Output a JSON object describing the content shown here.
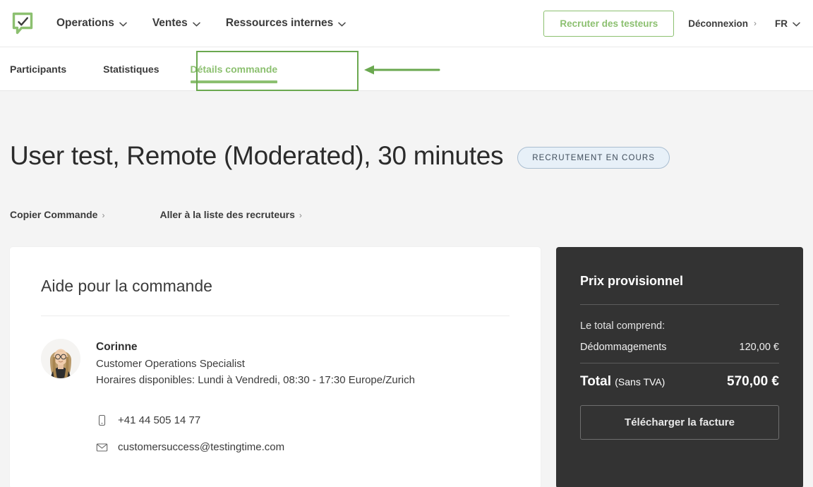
{
  "header": {
    "logo_icon": "speech-bubble-check-logo",
    "nav": [
      {
        "label": "Operations",
        "icon": "chevron-down-icon"
      },
      {
        "label": "Ventes",
        "icon": "chevron-down-icon"
      },
      {
        "label": "Ressources internes",
        "icon": "chevron-down-icon"
      }
    ],
    "recruit_button": "Recruter des testeurs",
    "logout": {
      "label": "Déconnexion",
      "caret": "›"
    },
    "language": {
      "label": "FR",
      "icon": "chevron-down-icon"
    },
    "accent_green": "#8cc070"
  },
  "tabs": [
    {
      "label": "Participants",
      "active": false
    },
    {
      "label": "Statistiques",
      "active": false
    },
    {
      "label": "Détails commande",
      "active": true
    }
  ],
  "annotation": {
    "box_color": "#6aa84f",
    "arrow_icon": "left-arrow-annotation",
    "target": "Détails commande"
  },
  "page": {
    "title": "User test, Remote (Moderated), 30 minutes",
    "status_badge": "RECRUTEMENT EN COURS",
    "status_badge_bg": "#e7f0f8",
    "status_badge_border": "#a9bdd0",
    "links": [
      {
        "label": "Copier Commande",
        "caret": "›"
      },
      {
        "label": "Aller à la liste des recruteurs",
        "caret": "›"
      }
    ]
  },
  "help_card": {
    "title": "Aide pour la commande",
    "avatar_icon": "person-avatar-photo",
    "contact": {
      "name": "Corinne",
      "role": "Customer Operations Specialist",
      "hours": "Horaires disponibles: Lundi à Vendredi, 08:30 - 17:30 Europe/Zurich"
    },
    "phone": {
      "icon": "mobile-phone-icon",
      "value": "+41 44 505 14 77"
    },
    "email": {
      "icon": "envelope-icon",
      "value": "customersuccess@testingtime.com"
    }
  },
  "price_panel": {
    "background": "#333333",
    "title": "Prix provisionnel",
    "subtitle": "Le total comprend:",
    "rows": [
      {
        "label": "Dédommagements",
        "value": "120,00 €"
      }
    ],
    "total_label": "Total",
    "total_note": "(Sans TVA)",
    "total_value": "570,00 €",
    "download_button": "Télécharger la facture"
  }
}
